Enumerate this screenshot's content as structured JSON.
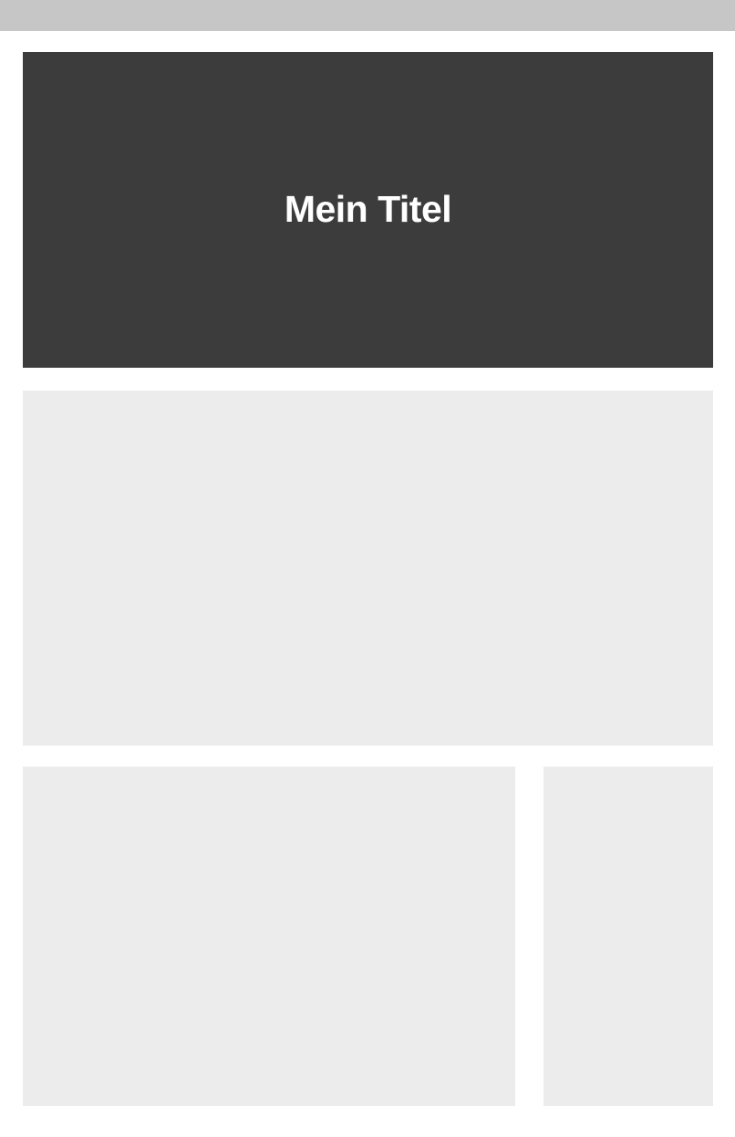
{
  "header": {
    "title": "Mein Titel"
  },
  "colors": {
    "top_bar": "#c6c6c6",
    "hero_background": "#3c3c3c",
    "hero_text": "#ffffff",
    "panel_background": "#ececec",
    "page_background": "#ffffff"
  }
}
